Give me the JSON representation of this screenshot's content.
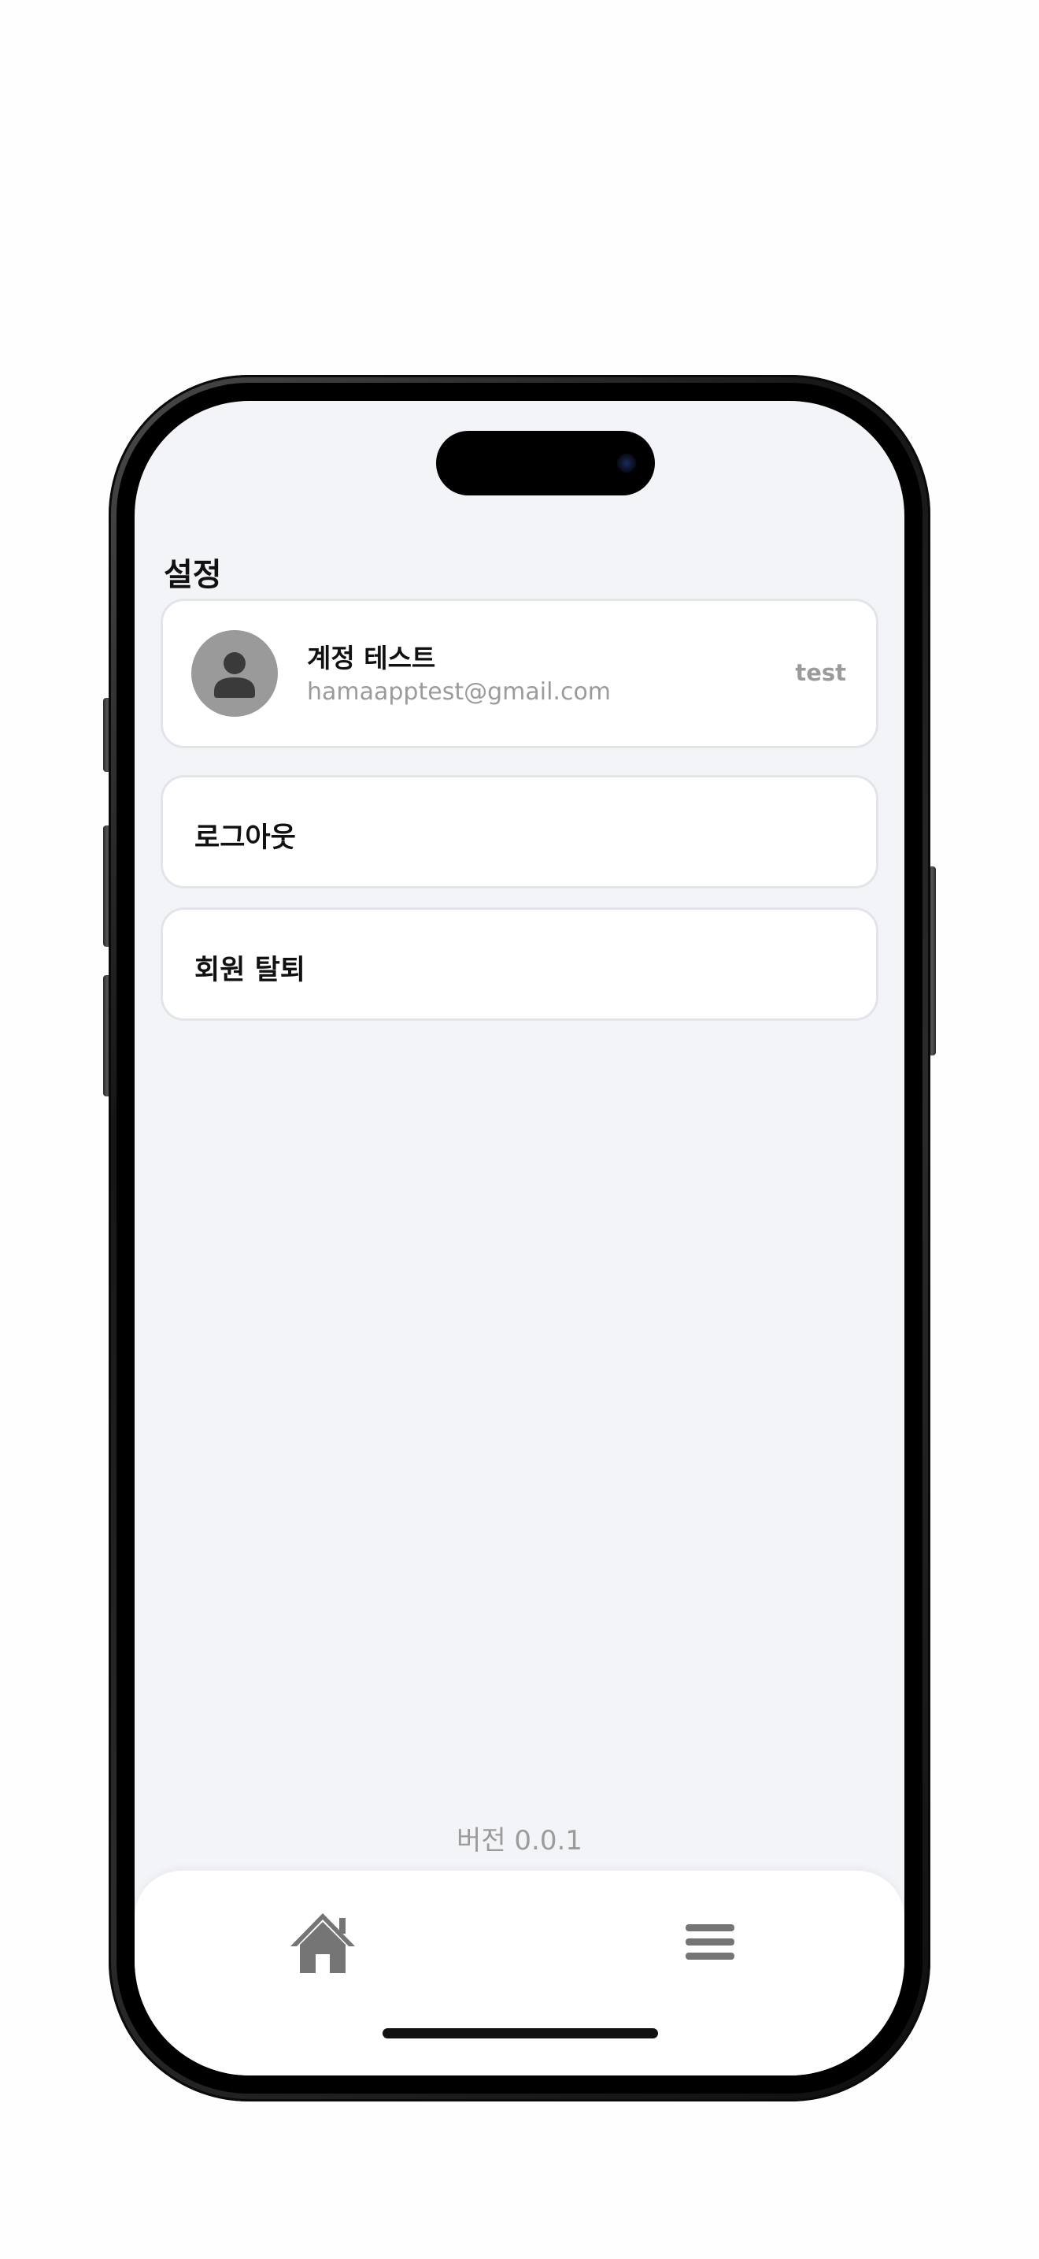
{
  "screen": {
    "title": "설정"
  },
  "account": {
    "name": "계정 테스트",
    "email": "hamaapptest@gmail.com",
    "id_label": "test",
    "avatar_icon": "person-icon"
  },
  "menu": {
    "items": [
      {
        "label": "로그아웃"
      },
      {
        "label": "회원 탈퇴"
      }
    ]
  },
  "footer": {
    "version": "버전 0.0.1"
  },
  "tab_bar": {
    "tabs": [
      {
        "icon": "home-icon"
      },
      {
        "icon": "menu-icon"
      }
    ]
  },
  "colors": {
    "screen_bg": "#f3f4f8",
    "card_bg": "#ffffff",
    "card_border": "#e3e4e9",
    "secondary_text": "#9b9b9b",
    "icon_gray": "#757575"
  }
}
